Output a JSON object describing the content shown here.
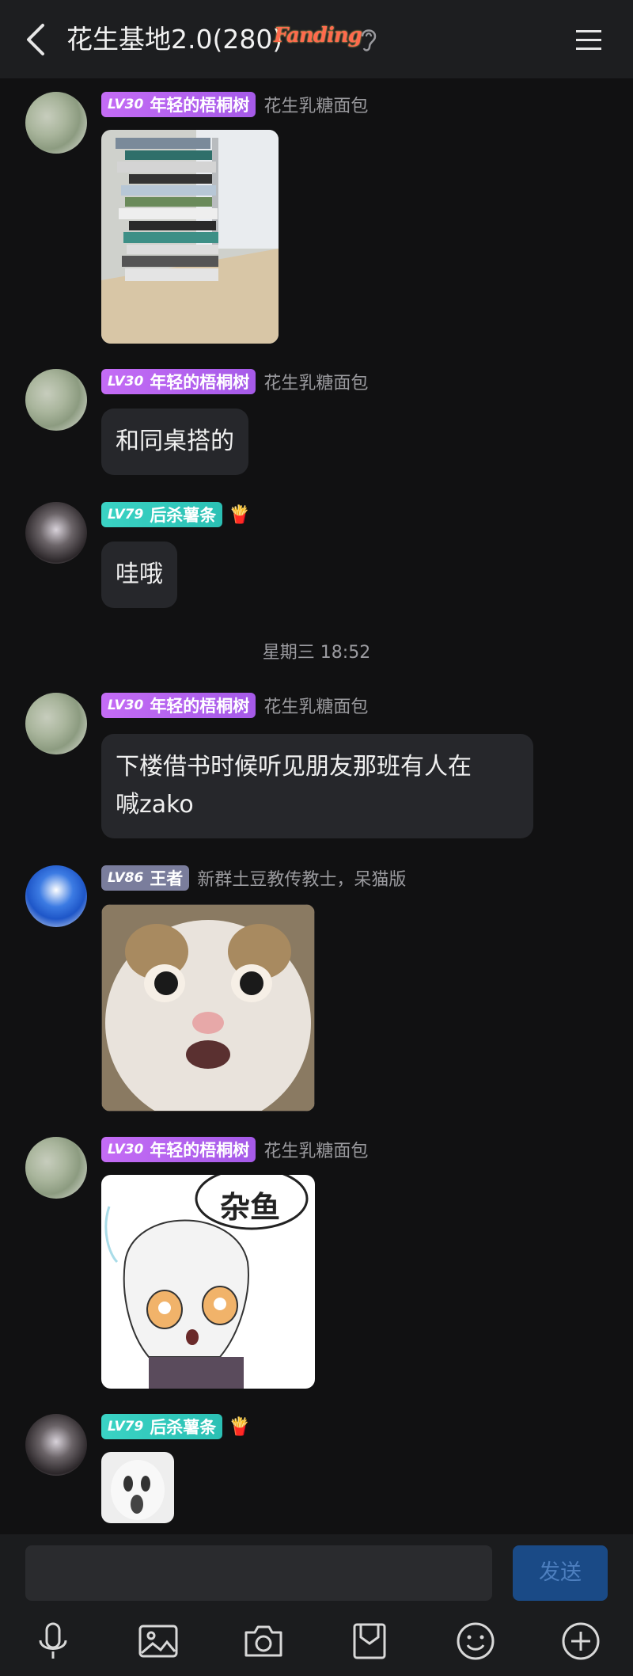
{
  "header": {
    "title": "花生基地2.0(280)",
    "logo_text": "Fanding"
  },
  "messages": [
    {
      "badge_level": "LV30",
      "badge_name": "年轻的梧桐树",
      "subname": "花生乳糖面包",
      "type": "image",
      "image": "stacked-books-photo"
    },
    {
      "badge_level": "LV30",
      "badge_name": "年轻的梧桐树",
      "subname": "花生乳糖面包",
      "type": "text",
      "text": "和同桌搭的"
    },
    {
      "badge_level": "LV79",
      "badge_name": "后杀薯条",
      "icon": "fries-icon",
      "type": "text",
      "text": "哇哦"
    },
    {
      "badge_level": "LV30",
      "badge_name": "年轻的梧桐树",
      "subname": "花生乳糖面包",
      "type": "text",
      "text_line1": "下楼借书时候听见朋友那班有人在",
      "text_line2": "喊zako"
    },
    {
      "badge_level": "LV86",
      "badge_name": "王者",
      "subname": "新群土豆教传教士，呆猫版",
      "type": "image",
      "image": "cat-face-meme"
    },
    {
      "badge_level": "LV30",
      "badge_name": "年轻的梧桐树",
      "subname": "花生乳糖面包",
      "type": "image",
      "image": "anime-sticker",
      "sticker_text": "杂鱼"
    },
    {
      "badge_level": "LV79",
      "badge_name": "后杀薯条",
      "icon": "fries-icon",
      "type": "image",
      "image": "small-ghost-sticker"
    }
  ],
  "timestamp": "星期三 18:52",
  "composer": {
    "placeholder": "",
    "send_label": "发送"
  },
  "toolbar": [
    "microphone-icon",
    "image-icon",
    "camera-icon",
    "file-icon",
    "emoji-icon",
    "add-icon"
  ],
  "colors": {
    "background": "#111112",
    "bubble": "#26272b",
    "badge_purple": "#b862ef",
    "badge_teal": "#33c9bc",
    "badge_gray": "#7a7d9c",
    "send": "#1a4a86"
  }
}
